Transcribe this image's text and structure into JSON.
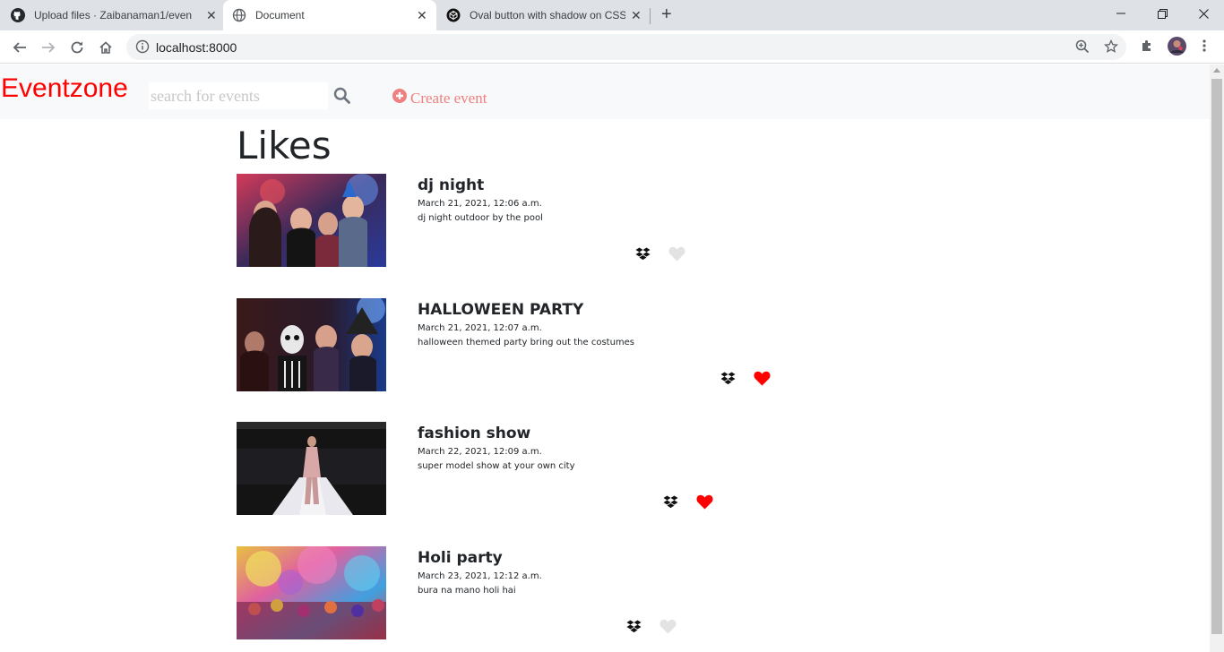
{
  "browser": {
    "tabs": [
      {
        "title": "Upload files · Zaibanaman1/event",
        "icon": "github-icon",
        "active": false
      },
      {
        "title": "Document",
        "icon": "globe-icon",
        "active": true
      },
      {
        "title": "Oval button with shadow on CSS",
        "icon": "codepen-icon",
        "active": false
      }
    ],
    "url": "localhost:8000"
  },
  "navbar": {
    "brand": "Eventzone",
    "search_placeholder": "search for events",
    "create_label": "Create event"
  },
  "page": {
    "heading": "Likes"
  },
  "events": [
    {
      "title": "dj night",
      "date": "March 21, 2021, 12:06 a.m.",
      "description": "dj night outdoor by the pool",
      "liked": false
    },
    {
      "title": "HALLOWEEN PARTY",
      "date": "March 21, 2021, 12:07 a.m.",
      "description": "halloween themed party bring out the costumes",
      "liked": true
    },
    {
      "title": "fashion show",
      "date": "March 22, 2021, 12:09 a.m.",
      "description": "super model show at your own city",
      "liked": true
    },
    {
      "title": "Holi party",
      "date": "March 23, 2021, 12:12 a.m.",
      "description": "bura na mano holi hai",
      "liked": false
    }
  ],
  "colors": {
    "brand": "#ff0000",
    "create": "#f07f7f",
    "heart_liked": "#ff0000",
    "heart_unliked": "#e3e3e3"
  }
}
